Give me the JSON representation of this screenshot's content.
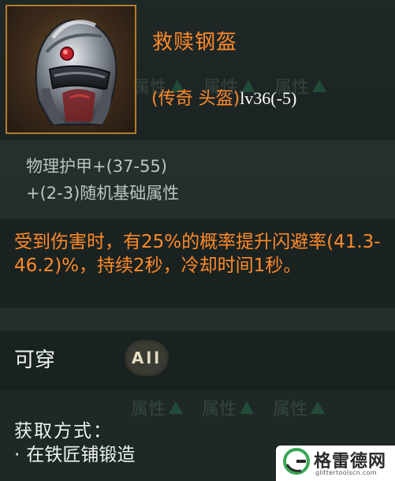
{
  "item": {
    "name": "救赎钢盔",
    "type_open": "(",
    "type_cn": "传奇 头盔",
    "type_close": ")",
    "level": "lv36(-5)",
    "icon": "helmet-icon"
  },
  "stats": [
    "物理护甲+(37-55)",
    "+(2-3)随机基础属性"
  ],
  "effect": {
    "text": "受到伤害时，有25%的概率提升闪避率(41.3-46.2)%，持续2秒，冷却时间1秒。"
  },
  "wearable": {
    "label": "可穿",
    "class": "All"
  },
  "watermark": {
    "label": "属性",
    "icon": "up-arrow-icon"
  },
  "obtain": {
    "title": "获取方式：",
    "bullet": "·",
    "method": "在铁匠铺锻造"
  },
  "site_logo": {
    "name": "格雷德网",
    "url": "glittertoolscn.com",
    "icon": "g-logo-icon"
  },
  "colors": {
    "legendary": "#ff8a2a",
    "frame": "#b37c2a",
    "background": "#1f2a28",
    "stat_text": "#b9c6c2"
  }
}
